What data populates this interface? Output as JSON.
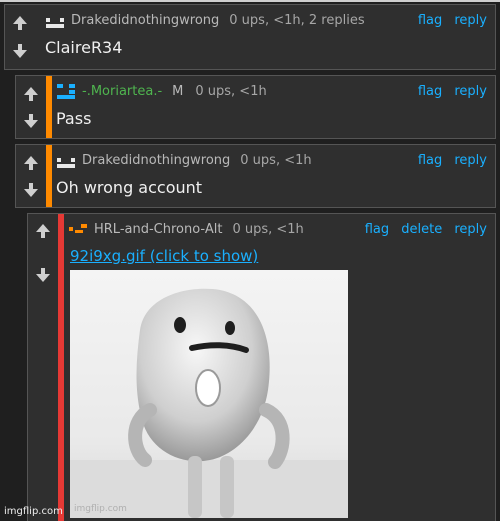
{
  "colors": {
    "accent_link": "#1ab0ff",
    "bar_orange": "#ff8a00",
    "bar_red": "#e53935",
    "username_green": "#4fb54f"
  },
  "comments": [
    {
      "username": "Drakedidnothingwrong",
      "meta": "0 ups, <1h, 2 replies",
      "text": "ClaireR34",
      "actions": [
        "flag",
        "reply"
      ]
    },
    {
      "username": "-.Moriartea.-",
      "flair": "M",
      "meta": "0 ups, <1h",
      "text": "Pass",
      "actions": [
        "flag",
        "reply"
      ]
    },
    {
      "username": "Drakedidnothingwrong",
      "meta": "0 ups, <1h",
      "text": "Oh wrong account",
      "actions": [
        "flag",
        "reply"
      ]
    },
    {
      "username": "HRL-and-Chrono-Alt",
      "meta": "0 ups, <1h",
      "link": "92i9xg.gif (click to show)",
      "image_watermark": "imgflip.com",
      "actions": [
        "flag",
        "delete",
        "reply"
      ]
    }
  ],
  "footer": {
    "watermark": "imgflip.com"
  }
}
